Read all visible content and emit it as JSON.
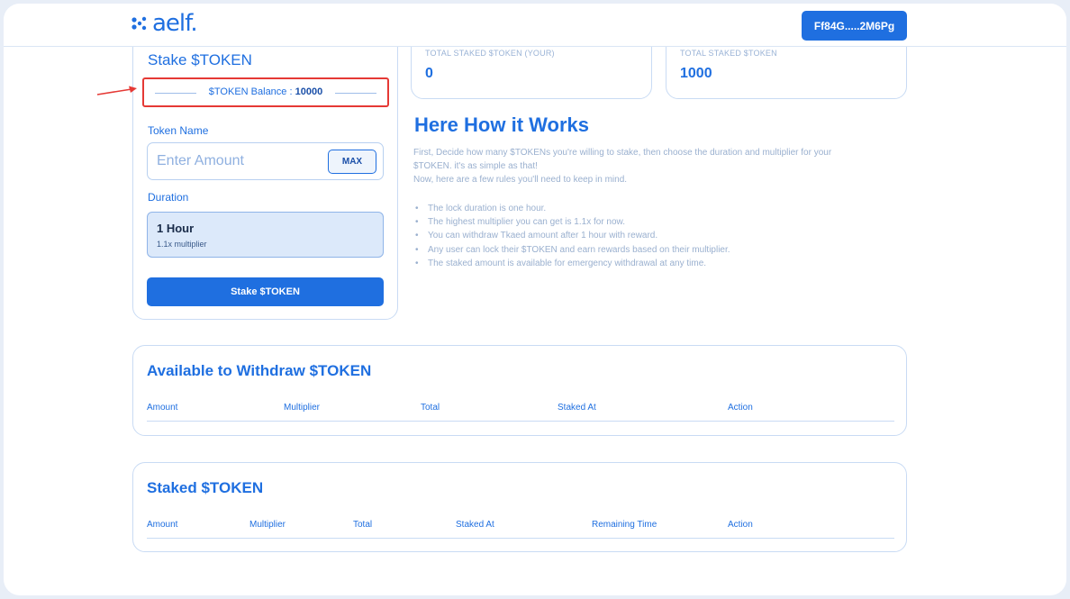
{
  "navbar": {
    "logo_text": "aelf.",
    "wallet_label": "Ff84G.....2M6Pg"
  },
  "stake": {
    "title": "Stake $TOKEN",
    "balance_label": "$TOKEN Balance : ",
    "balance_value": "10000",
    "token_name_label": "Token Name",
    "amount_placeholder": "Enter Amount",
    "max_label": "MAX",
    "duration_label": "Duration",
    "duration_option": {
      "title": "1 Hour",
      "subtitle": "1.1x multiplier"
    },
    "stake_button": "Stake $TOKEN"
  },
  "stats": [
    {
      "label": "TOTAL STAKED $TOKEN (YOUR)",
      "value": "0"
    },
    {
      "label": "TOTAL STAKED $TOKEN",
      "value": "1000"
    }
  ],
  "how": {
    "title": "Here How it Works",
    "intro_1": "First, Decide how many $TOKENs you're willing to stake, then choose the duration and multiplier for your",
    "intro_2": "$TOKEN. it's as simple as that!",
    "intro_3": "Now, here are a few rules you'll need to keep in mind.",
    "rules": [
      "The lock duration is one hour.",
      "The highest multiplier you can get is 1.1x for now.",
      "You can withdraw Tkaed amount after 1 hour with reward.",
      "Any user can lock their $TOKEN and earn rewards based on their multiplier.",
      "The staked amount is available for emergency withdrawal at any time."
    ]
  },
  "withdraw_table": {
    "title": "Available to Withdraw $TOKEN",
    "columns": [
      "Amount",
      "Multiplier",
      "Total",
      "Staked At",
      "Action"
    ]
  },
  "staked_table": {
    "title": "Staked $TOKEN",
    "columns": [
      "Amount",
      "Multiplier",
      "Total",
      "Staked At",
      "Remaining Time",
      "Action"
    ]
  },
  "colors": {
    "accent": "#1f6fe0",
    "highlight": "#e53935"
  }
}
